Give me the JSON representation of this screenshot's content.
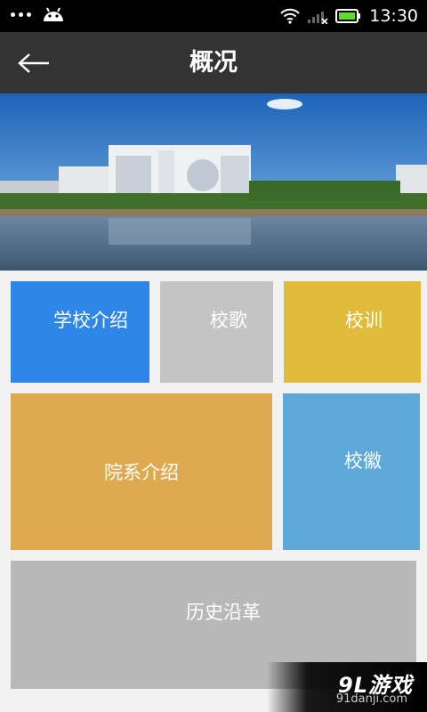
{
  "status_bar": {
    "time": "13:30",
    "icons": [
      "more-dots-icon",
      "android-icon",
      "wifi-icon",
      "signal-icon",
      "battery-icon"
    ]
  },
  "header": {
    "title": "概况",
    "back_icon": "arrow-left-icon"
  },
  "tiles": [
    {
      "label": "学校介绍",
      "color": "#2e86e8"
    },
    {
      "label": "校歌",
      "color": "#c4c4c4"
    },
    {
      "label": "校训",
      "color": "#e2bb3c"
    },
    {
      "label": "院系介绍",
      "color": "#dea94f"
    },
    {
      "label": "校徽",
      "color": "#5ea8da"
    },
    {
      "label": "历史沿革",
      "color": "#b8b8b8"
    }
  ],
  "watermark": {
    "main": "9L游戏",
    "sub": "91danji.com"
  }
}
